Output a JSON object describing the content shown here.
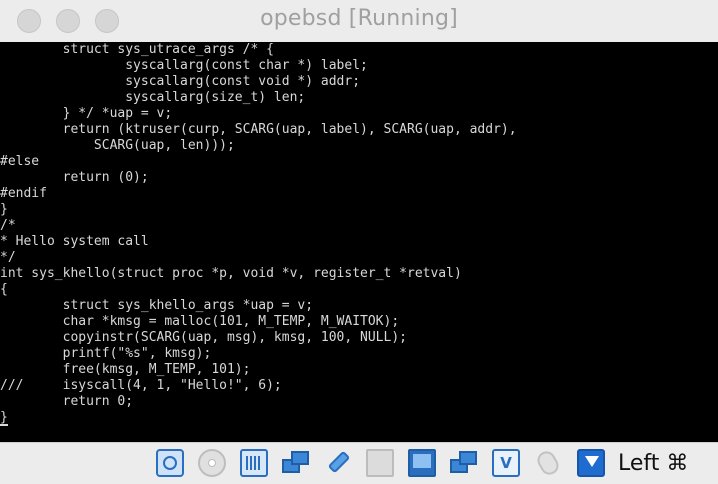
{
  "window": {
    "title": "opebsd [Running]"
  },
  "console": {
    "lines": [
      "        struct sys_utrace_args /* {",
      "                syscallarg(const char *) label;",
      "                syscallarg(const void *) addr;",
      "                syscallarg(size_t) len;",
      "        } */ *uap = v;",
      "        return (ktruser(curp, SCARG(uap, label), SCARG(uap, addr),",
      "            SCARG(uap, len)));",
      "#else",
      "        return (0);",
      "#endif",
      "}",
      "/*",
      "* Hello system call",
      "*/",
      "int sys_khello(struct proc *p, void *v, register_t *retval)",
      "{",
      "        struct sys_khello_args *uap = v;",
      "        char *kmsg = malloc(101, M_TEMP, M_WAITOK);",
      "        copyinstr(SCARG(uap, msg), kmsg, 100, NULL);",
      "        printf(\"%s\", kmsg);",
      "        free(kmsg, M_TEMP, 101);",
      "///     isyscall(4, 1, \"Hello!\", 6);",
      "        return 0;",
      "}"
    ]
  },
  "statusbar": {
    "host_key": "Left ⌘",
    "icons": [
      "optical-drive-icon",
      "hard-disk-icon",
      "audio-icon",
      "network-icon",
      "usb-icon",
      "shared-folders-icon",
      "display-icon",
      "video-capture-icon",
      "virtualization-icon",
      "mouse-integration-icon",
      "keyboard-capture-icon"
    ]
  }
}
